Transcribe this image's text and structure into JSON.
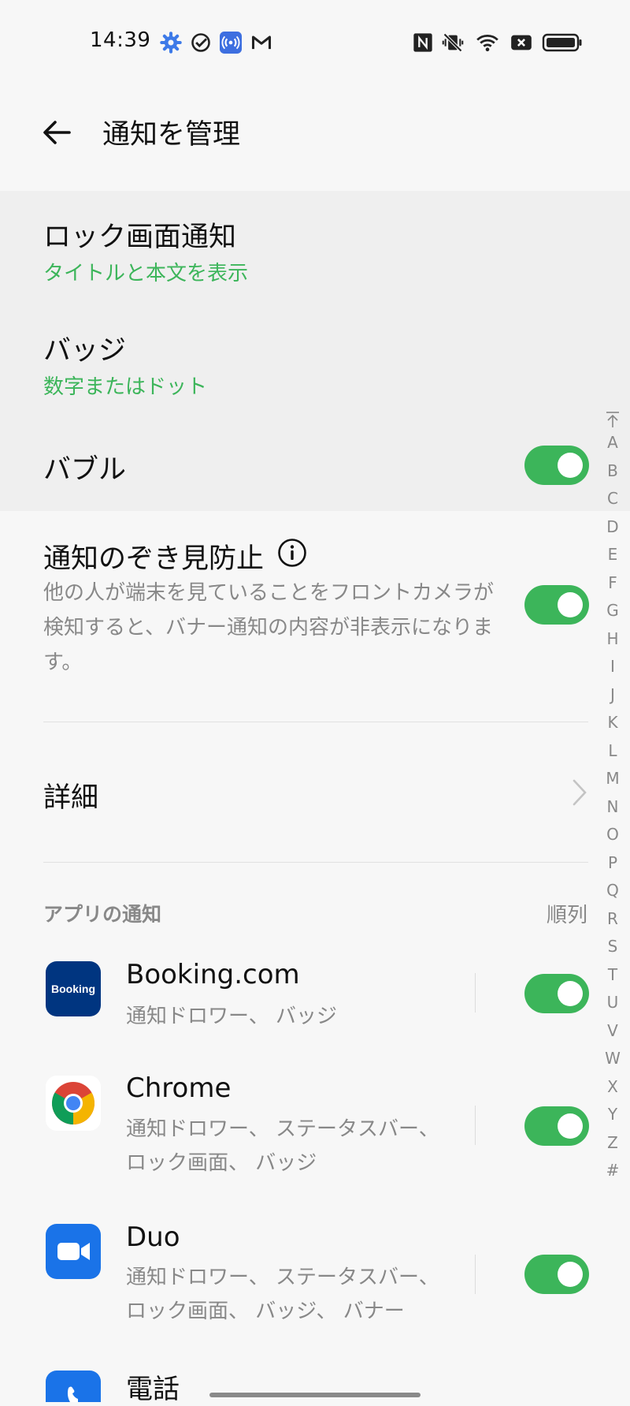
{
  "status_bar": {
    "time": "14:39",
    "left_icons": [
      "gear-icon",
      "check-circle-icon",
      "broadcast-icon",
      "gmail-icon"
    ],
    "right_icons": [
      "nfc-icon",
      "vibrate-off-icon",
      "wifi-icon",
      "sim-x-icon",
      "battery-icon"
    ]
  },
  "header": {
    "title": "通知を管理"
  },
  "settings": {
    "lock_screen": {
      "title": "ロック画面通知",
      "value": "タイトルと本文を表示"
    },
    "badge": {
      "title": "バッジ",
      "value": "数字またはドット"
    },
    "bubble": {
      "title": "バブル",
      "enabled": true
    },
    "peek_protection": {
      "title": "通知のぞき見防止",
      "description": "他の人が端末を見ていることをフロントカメラが検知すると、バナー通知の内容が非表示になります。",
      "enabled": true
    },
    "details": {
      "title": "詳細"
    }
  },
  "apps_section": {
    "header": "アプリの通知",
    "sort_label": "順列",
    "apps": [
      {
        "name": "Booking.com",
        "icon_text": "Booking",
        "summary": "通知ドロワー、 バッジ",
        "enabled": true
      },
      {
        "name": "Chrome",
        "summary": "通知ドロワー、 ステータスバー、 ロック画面、 バッジ",
        "enabled": true
      },
      {
        "name": "Duo",
        "summary": "通知ドロワー、 ステータスバー、 ロック画面、 バッジ、 バナー",
        "enabled": true
      },
      {
        "name": "電話"
      }
    ]
  },
  "index_bar": [
    "A",
    "B",
    "C",
    "D",
    "E",
    "F",
    "G",
    "H",
    "I",
    "J",
    "K",
    "L",
    "M",
    "N",
    "O",
    "P",
    "Q",
    "R",
    "S",
    "T",
    "U",
    "V",
    "W",
    "X",
    "Y",
    "Z",
    "#"
  ],
  "colors": {
    "accent_green": "#3cb55a",
    "booking_blue": "#003580",
    "duo_blue": "#1a73e8"
  }
}
